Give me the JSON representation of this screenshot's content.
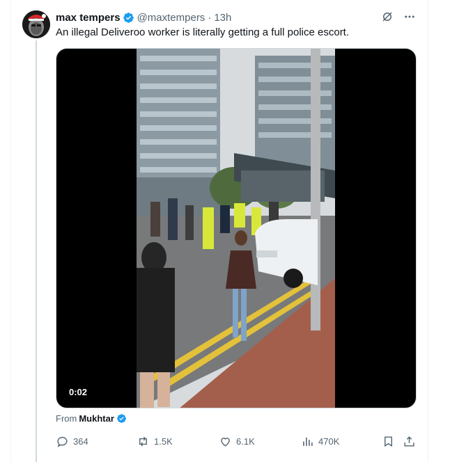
{
  "tweet": {
    "display_name": "max tempers",
    "handle": "@maxtempers",
    "separator": "·",
    "time": "13h",
    "text": "An illegal Deliveroo worker is literally getting a full police escort.",
    "video": {
      "duration": "0:02"
    },
    "source": {
      "prefix": "From",
      "name": "Mukhtar"
    },
    "stats": {
      "replies": "364",
      "reposts": "1.5K",
      "likes": "6.1K",
      "views": "470K"
    }
  },
  "colors": {
    "verified": "#1d9bf0",
    "muted_text": "#536471",
    "thread_line": "#cfd9de"
  },
  "icons": [
    "avatar",
    "verified-badge-icon",
    "grok-icon",
    "more-icon",
    "reply-icon",
    "repost-icon",
    "like-icon",
    "views-icon",
    "bookmark-icon",
    "share-icon"
  ]
}
